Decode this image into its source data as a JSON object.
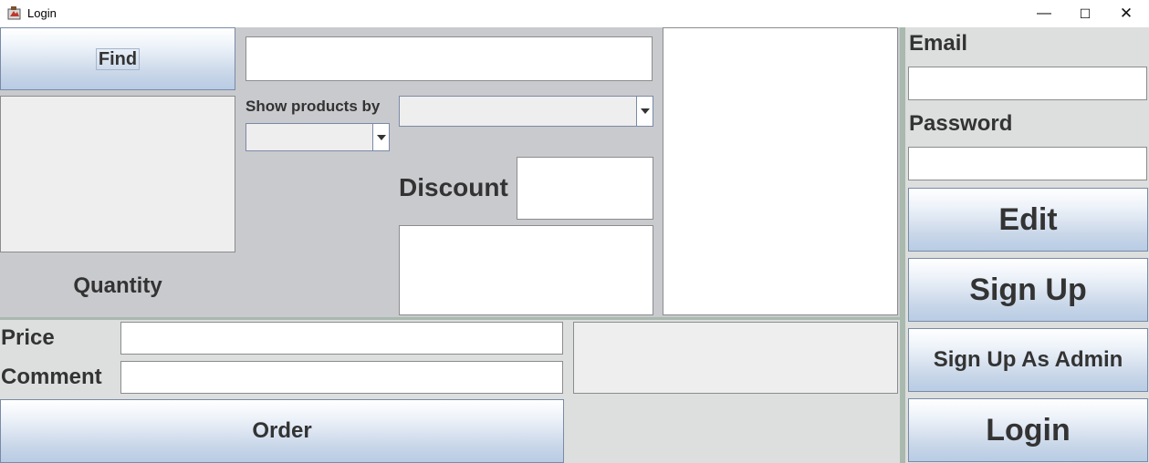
{
  "window": {
    "title": "Login",
    "icons": {
      "app": "java-app-icon",
      "minimize": "minimize-icon",
      "maximize": "maximize-icon",
      "close": "close-icon"
    },
    "glyphs": {
      "minimize": "—",
      "maximize": "☐",
      "close": "✕"
    }
  },
  "product_panel": {
    "find_label": "Find",
    "search_value": "",
    "show_by_label": "Show products by",
    "show_by_selected": "",
    "sort_selected": "",
    "discount_label": "Discount",
    "discount_value": "",
    "quantity_label": "Quantity"
  },
  "order_panel": {
    "price_label": "Price",
    "price_value": "",
    "comment_label": "Comment",
    "comment_value": "",
    "order_label": "Order"
  },
  "account_panel": {
    "email_label": "Email",
    "email_value": "",
    "password_label": "Password",
    "password_value": "",
    "edit_label": "Edit",
    "signup_label": "Sign Up",
    "signup_admin_label": "Sign Up As Admin",
    "login_label": "Login"
  },
  "colors": {
    "top_panel": "#c9cace",
    "bottom_panel": "#dcdfde",
    "accent_border": "#a9b9ae",
    "button_text": "#333333"
  }
}
